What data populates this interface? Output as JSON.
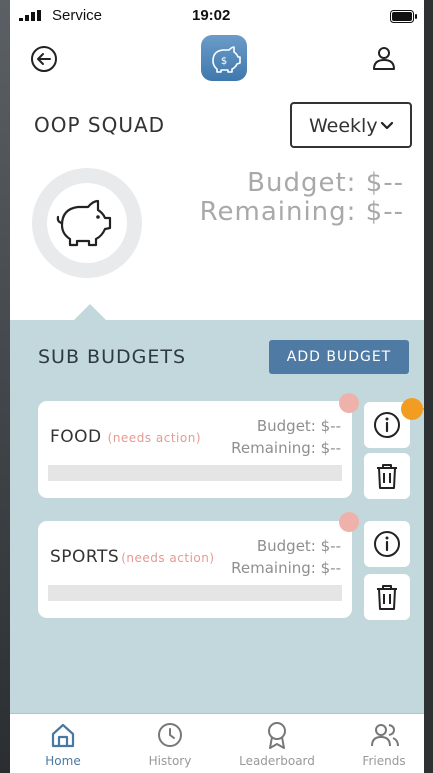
{
  "status_bar": {
    "carrier": "Service",
    "time": "19:02"
  },
  "header": {
    "logo_icon": "piggy-bank-dollar-icon",
    "back_icon": "back-arrow-icon",
    "profile_icon": "user-icon"
  },
  "group": {
    "name": "OOP SQUAD"
  },
  "period": {
    "selected": "Weekly"
  },
  "summary": {
    "budget": "Budget: $--",
    "remaining": "Remaining: $--",
    "icon": "piggy-bank-icon"
  },
  "sub_budgets": {
    "title": "SUB BUDGETS",
    "add_label": "ADD BUDGET",
    "items": [
      {
        "name": "FOOD",
        "status": "(needs action)",
        "budget": "Budget: $--",
        "remaining": "Remaining: $--"
      },
      {
        "name": "SPORTS",
        "status": "(needs action)",
        "budget": "Budget: $--",
        "remaining": "Remaining: $--"
      }
    ]
  },
  "tabs": [
    {
      "label": "Home",
      "icon": "home-icon",
      "active": true
    },
    {
      "label": "History",
      "icon": "clock-icon",
      "active": false
    },
    {
      "label": "Leaderboard",
      "icon": "award-icon",
      "active": false
    },
    {
      "label": "Friends",
      "icon": "users-icon",
      "active": false
    }
  ],
  "colors": {
    "accent": "#4f7aa3",
    "panel": "#c2d8dd",
    "status_warning": "#e59a92",
    "notification": "#efb2ab",
    "highlight": "#f39c22"
  }
}
